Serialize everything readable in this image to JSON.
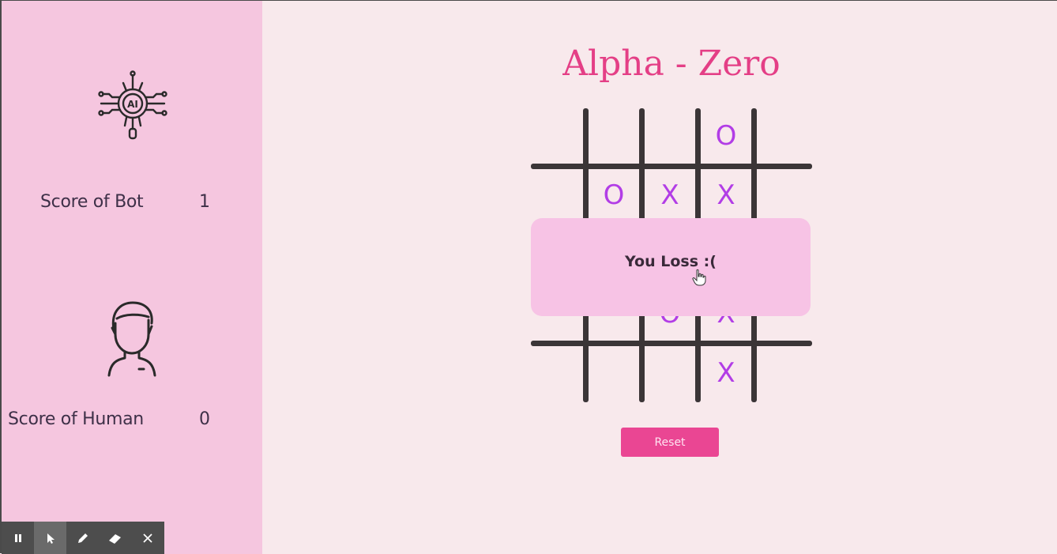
{
  "game": {
    "title": "Alpha - Zero",
    "board": [
      [
        "",
        "",
        "O"
      ],
      [
        "O",
        "X",
        "X"
      ],
      [
        "",
        "O",
        "X"
      ],
      [
        "",
        "",
        "X"
      ]
    ],
    "popup_message": "You Loss :(",
    "reset_label": "Reset"
  },
  "scores": {
    "bot_label": "Score of Bot",
    "bot_value": "1",
    "human_label": "Score of Human",
    "human_value": "0"
  },
  "icons": {
    "bot": "ai-chip-icon",
    "human": "person-icon"
  },
  "toolbar": {
    "tools": [
      "pause-icon",
      "pointer-icon",
      "pen-icon",
      "eraser-icon",
      "close-icon"
    ]
  },
  "colors": {
    "sidebar": "#f5c6df",
    "background": "#f8e9ec",
    "title": "#e43f86",
    "marks": "#b23de6",
    "reset_button": "#ea4693",
    "popup": "#f7c3e5"
  }
}
